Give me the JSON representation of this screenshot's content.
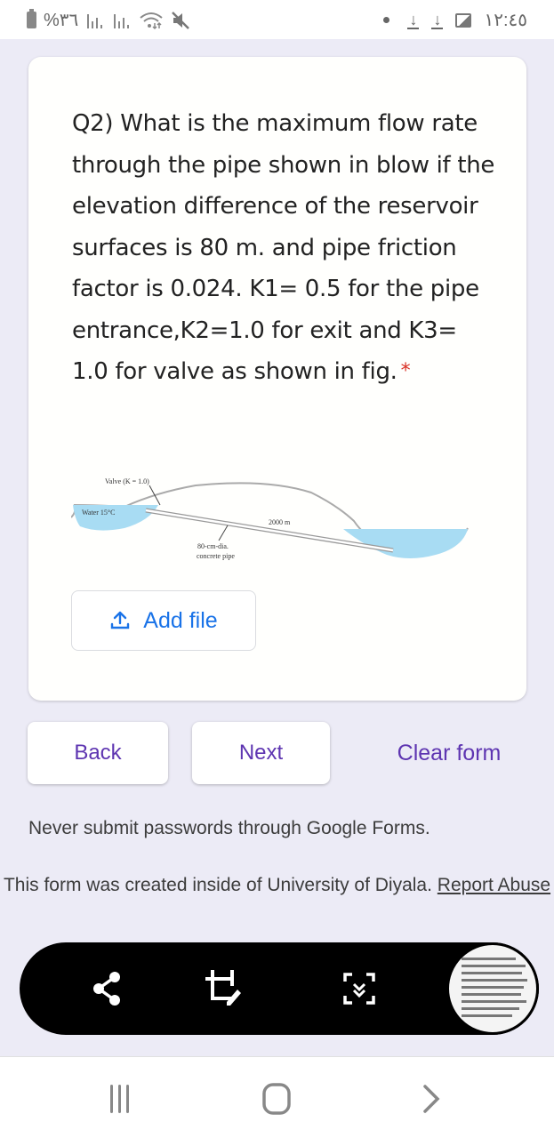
{
  "status_bar": {
    "battery_text": "%٣٦",
    "signal_icons": [
      "signal-icon",
      "signal-icon"
    ],
    "wifi_icon": "wifi-icon",
    "mute_icon": "mute-icon",
    "notification_icons": [
      "dot-icon",
      "download-icon",
      "download-icon",
      "image-icon"
    ],
    "time": "١٢:٤٥"
  },
  "question": {
    "text": "Q2) What is the maximum flow rate through the pipe shown in blow if the elevation difference of the reservoir surfaces is 80 m. and pipe friction factor is 0.024. K1= 0.5 for the pipe entrance,K2=1.0 for exit and K3= 1.0 for valve as shown in fig.",
    "required_marker": "*",
    "figure": {
      "valve_label": "Valve (K = 1.0)",
      "water_label": "Water 15°C",
      "length_label": "2000 m",
      "pipe_label_line1": "80-cm-dia.",
      "pipe_label_line2": "concrete pipe"
    },
    "add_file_label": "Add file"
  },
  "navigation": {
    "back_label": "Back",
    "next_label": "Next",
    "clear_label": "Clear form"
  },
  "footer": {
    "warning": "Never submit passwords through Google Forms.",
    "created_text": "This form was created inside of University of Diyala.",
    "report_link": "Report Abuse"
  },
  "screenshot_toolbar": {
    "buttons": [
      "share-icon",
      "crop-edit-icon",
      "scroll-capture-icon"
    ],
    "thumbnail": "screenshot-thumbnail"
  },
  "system_nav": {
    "buttons": [
      "recents-icon",
      "home-icon",
      "back-icon"
    ]
  },
  "colors": {
    "accent_purple": "#5e35b1",
    "link_blue": "#1a73e8",
    "required_red": "#d93025",
    "background": "#ecebf6"
  }
}
